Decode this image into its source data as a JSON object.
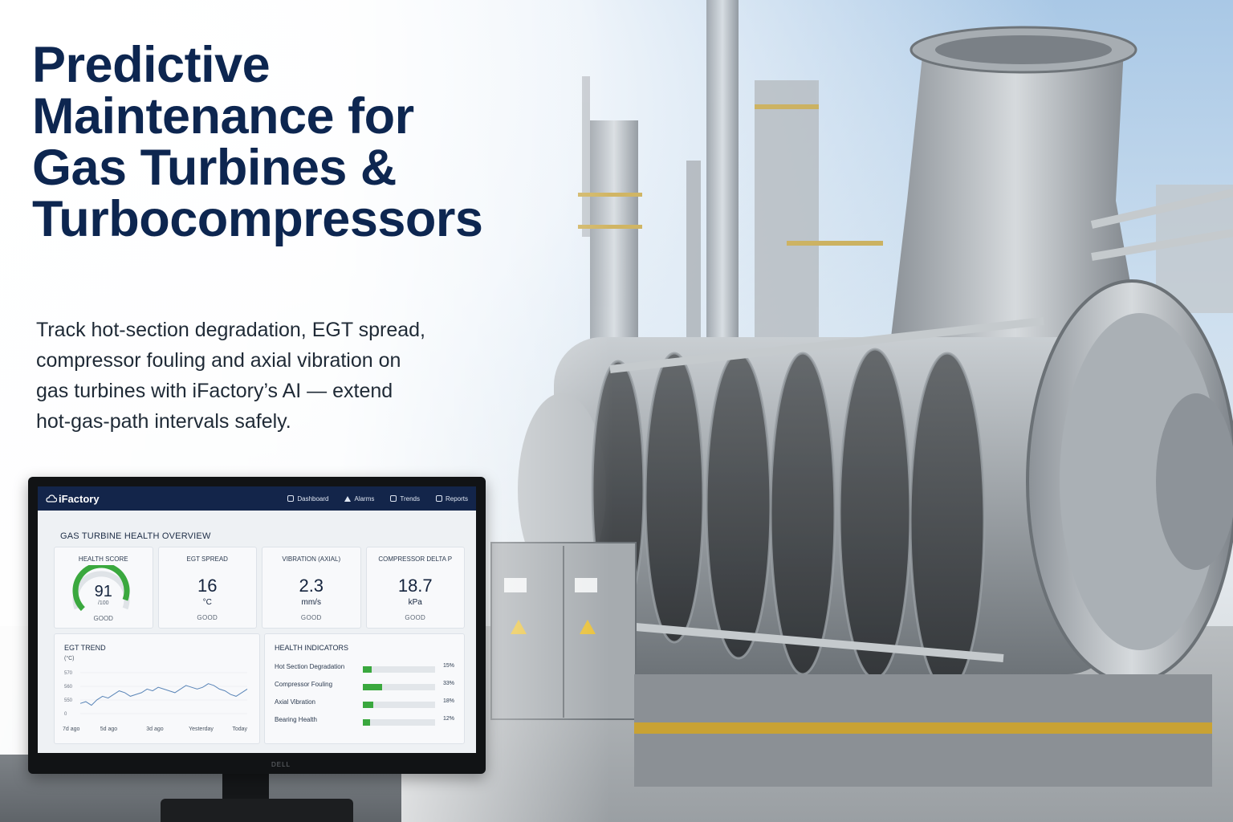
{
  "headline": {
    "lines": [
      "Predictive",
      "Maintenance for",
      "Gas Turbines &",
      "Turbocompressors"
    ],
    "color": "#0d2650"
  },
  "subtitle_lines": [
    "Track hot-section degradation, EGT spread,",
    "compressor fouling and axial vibration on",
    "gas turbines with iFactory’s AI — extend",
    "hot-gas-path intervals safely."
  ],
  "monitor": {
    "brand": "DELL",
    "app": {
      "logo": "iFactory",
      "logo_icon": "cloud-icon",
      "nav": [
        {
          "label": "Dashboard",
          "icon": "dashboard-icon"
        },
        {
          "label": "Alarms",
          "icon": "alarm-icon"
        },
        {
          "label": "Trends",
          "icon": "trends-icon"
        },
        {
          "label": "Reports",
          "icon": "reports-icon"
        }
      ],
      "section_title": "GAS TURBINE HEALTH OVERVIEW",
      "health_score": {
        "label": "HEALTH SCORE",
        "value": "91",
        "max": "/100",
        "status": "GOOD",
        "fraction": 0.91
      },
      "kpis": [
        {
          "label": "EGT SPREAD",
          "value": "16",
          "unit": "°C",
          "status": "GOOD"
        },
        {
          "label": "VIBRATION (AXIAL)",
          "value": "2.3",
          "unit": "mm/s",
          "status": "GOOD"
        },
        {
          "label": "COMPRESSOR DELTA P",
          "value": "18.7",
          "unit": "kPa",
          "status": "GOOD"
        }
      ],
      "egt_trend": {
        "title": "EGT TREND",
        "unit": "(°C)",
        "ticks_y": [
          "570",
          "560",
          "550",
          "0"
        ],
        "ticks_x": [
          "7d ago",
          "5d ago",
          "3d ago",
          "Yesterday",
          "Today"
        ],
        "series": [
          552,
          553,
          551,
          554,
          556,
          555,
          557,
          559,
          558,
          556,
          557,
          558,
          560,
          559,
          561,
          560,
          559,
          558,
          560,
          562,
          561,
          560,
          561,
          563,
          562,
          560,
          559,
          557,
          556,
          558,
          560
        ]
      },
      "health_indicators": {
        "title": "HEALTH INDICATORS",
        "items": [
          {
            "label": "Hot Section Degradation",
            "pct_text": "15%",
            "value": 0.15
          },
          {
            "label": "Compressor Fouling",
            "pct_text": "33%",
            "value": 0.33
          },
          {
            "label": "Axial Vibration",
            "pct_text": "18%",
            "value": 0.18
          },
          {
            "label": "Bearing Health",
            "pct_text": "12%",
            "value": 0.12
          }
        ],
        "bar_color": "#3aa83e"
      }
    }
  }
}
